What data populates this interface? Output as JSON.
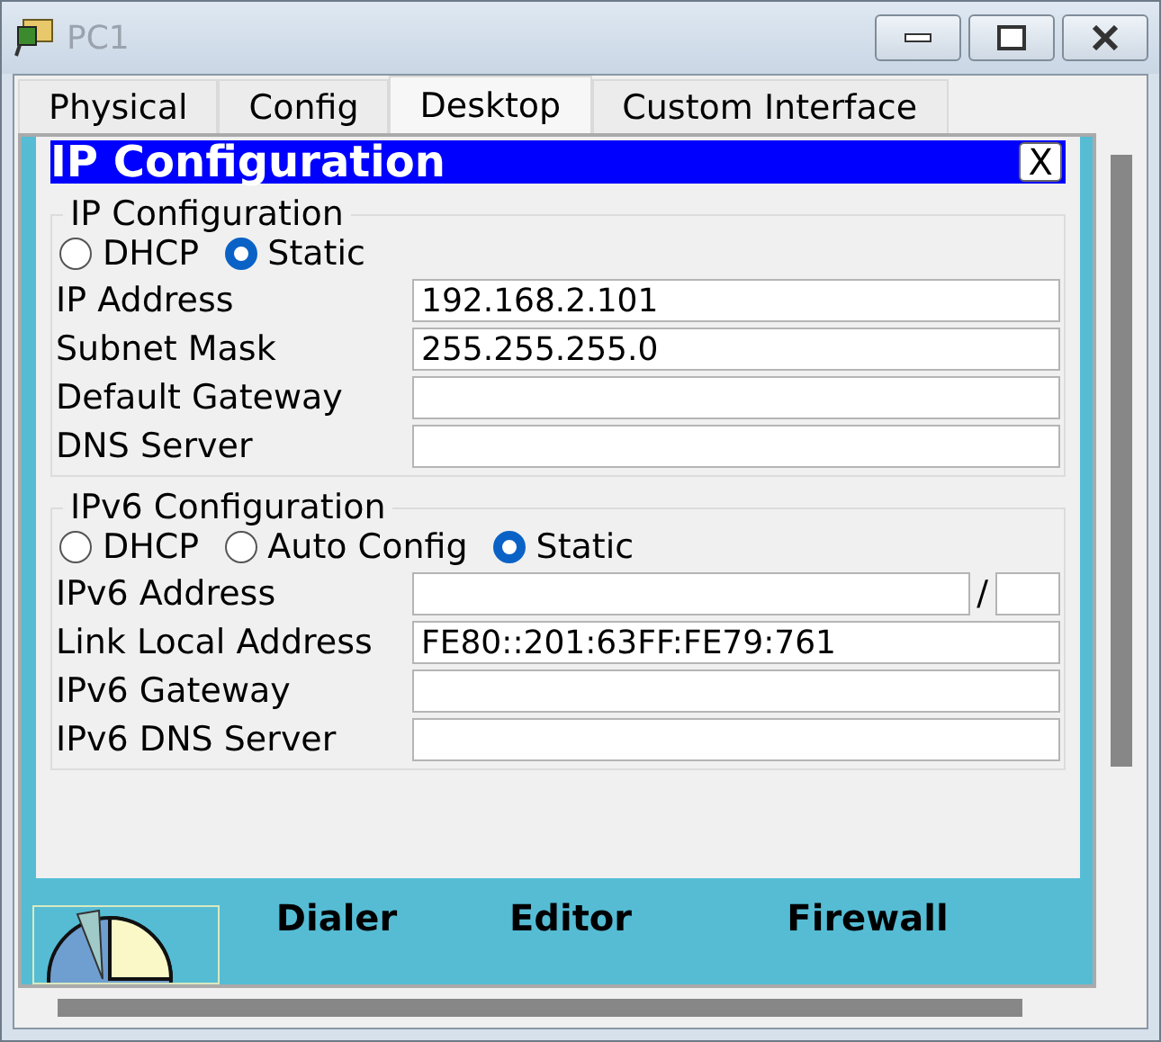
{
  "window": {
    "title": "PC1"
  },
  "tabs": [
    {
      "label": "Physical",
      "selected": false
    },
    {
      "label": "Config",
      "selected": false
    },
    {
      "label": "Desktop",
      "selected": true
    },
    {
      "label": "Custom Interface",
      "selected": false
    }
  ],
  "dialog": {
    "title": "IP Configuration",
    "close": "X",
    "sections": [
      {
        "legend": "IP Configuration",
        "modes": [
          {
            "label": "DHCP",
            "selected": false
          },
          {
            "label": "Static",
            "selected": true
          }
        ],
        "fields": [
          {
            "kind": "text",
            "label": "IP Address",
            "value": "192.168.2.101"
          },
          {
            "kind": "text",
            "label": "Subnet Mask",
            "value": "255.255.255.0"
          },
          {
            "kind": "text",
            "label": "Default Gateway"
          },
          {
            "kind": "text",
            "label": "DNS Server"
          }
        ]
      },
      {
        "legend": "IPv6 Configuration",
        "modes": [
          {
            "label": "DHCP",
            "selected": false
          },
          {
            "label": "Auto Config",
            "selected": false
          },
          {
            "label": "Static",
            "selected": true
          }
        ],
        "fields": [
          {
            "kind": "prefixed",
            "label": "IPv6 Address",
            "separator": "/"
          },
          {
            "kind": "text",
            "label": "Link Local Address",
            "value": "FE80::201:63FF:FE79:761"
          },
          {
            "kind": "text",
            "label": "IPv6 Gateway"
          },
          {
            "kind": "text",
            "label": "IPv6 DNS Server"
          }
        ]
      }
    ]
  },
  "desktop": {
    "apps": [
      {
        "label": "Dialer"
      },
      {
        "label": "Editor"
      },
      {
        "label": "Firewall"
      }
    ]
  }
}
